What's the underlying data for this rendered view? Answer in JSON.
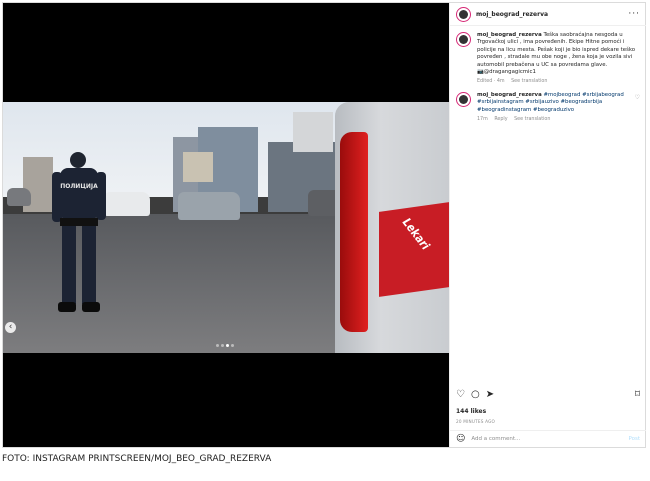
{
  "post": {
    "username": "moj_beograd_rezerva",
    "more_label": "···",
    "caption_user": "moj_beograd_rezerva",
    "caption_text": "Teška saobraćajna nesgoda u Trgovačkoj ulici , ima povređenih. Ekipe Hitne pomoći i policije na licu mesta. Pešak koji je bio ispred dekare teško povređen , stradale mu obe noge , žena koja je vozila sivi automobil prebačena u UC sa povredama glave.",
    "caption_mention": "📷@dragangagicmic1",
    "caption_time": "Edited · 4m",
    "caption_translate": "See translation",
    "comment_user": "moj_beograd_rezerva",
    "comment_tags": "#mojbeograd #srbijabeograd #srbijainstagram #srbijauzivo #beogradsrbija #beogradinstagram #beograduzivo",
    "comment_time": "17m",
    "comment_reply": "Reply",
    "comment_translate": "See translation",
    "likes": "144 likes",
    "date": "20 MINUTES AGO",
    "add_comment_placeholder": "Add a comment...",
    "post_button": "Post"
  },
  "photo": {
    "police_text": "ПОЛИЦИЈА",
    "van_logo_text": "Lekari",
    "carousel_total": 4,
    "carousel_active": 3
  },
  "icons": {
    "like": "heart-icon",
    "comment": "comment-icon",
    "share": "share-icon",
    "save": "bookmark-icon",
    "emoji": "emoji-icon",
    "prev": "chevron-left-icon"
  },
  "footer": {
    "photo_credit": "FOTO: INSTAGRAM PRINTSCREEN/MOJ_BEO_GRAD_REZERVA"
  }
}
